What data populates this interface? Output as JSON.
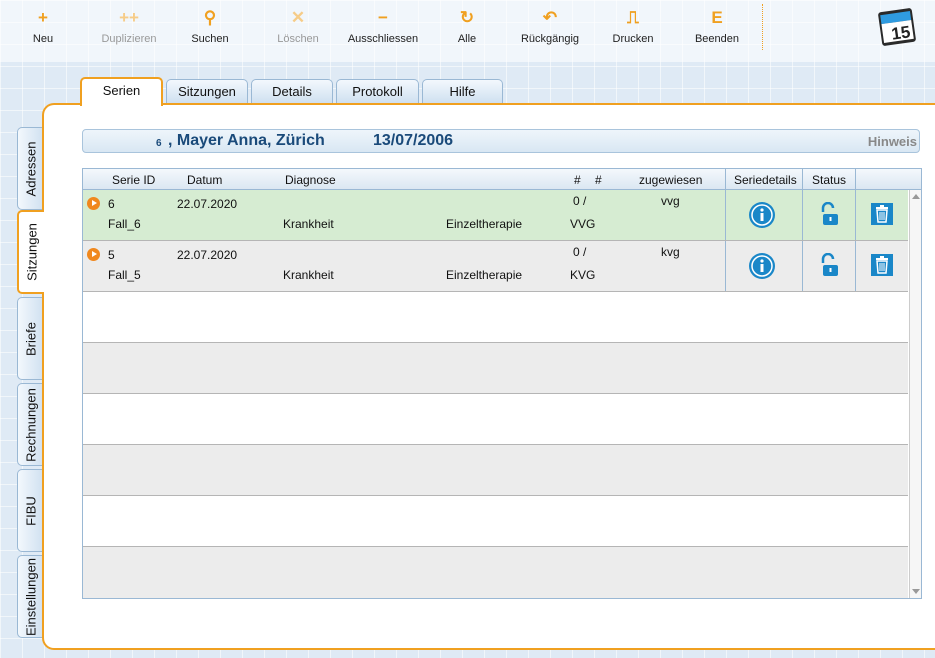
{
  "toolbar": {
    "buttons": [
      {
        "label": "Neu",
        "icon": "+",
        "enabled": true
      },
      {
        "label": "Duplizieren",
        "icon": "++",
        "enabled": false
      },
      {
        "label": "Suchen",
        "icon": "⚲",
        "enabled": true
      },
      {
        "label": "Löschen",
        "icon": "✕",
        "enabled": false
      },
      {
        "label": "Ausschliessen",
        "icon": "−",
        "enabled": true
      },
      {
        "label": "Alle",
        "icon": "↻",
        "enabled": true
      },
      {
        "label": "Rückgängig",
        "icon": "↶",
        "enabled": true
      },
      {
        "label": "Drucken",
        "icon": "⎍",
        "enabled": true
      },
      {
        "label": "Beenden",
        "icon": "E",
        "enabled": true
      }
    ],
    "calendar_day": "15",
    "accent_color": "#f0a020"
  },
  "top_tabs": [
    "Serien",
    "Sitzungen",
    "Details",
    "Protokoll",
    "Hilfe"
  ],
  "active_top_tab": "Serien",
  "side_tabs": [
    "Adressen",
    "Sitzungen",
    "Briefe",
    "Rechnungen",
    "FIBU",
    "Einstellungen"
  ],
  "active_side_tab": "Sitzungen",
  "patient": {
    "id": "6",
    "name": ", Mayer Anna, Zürich",
    "date": "13/07/2006",
    "hinweis": "Hinweis"
  },
  "table": {
    "headers": {
      "serie_id": "Serie ID",
      "datum": "Datum",
      "diagnose": "Diagnose",
      "hash1": "#",
      "hash2": "#",
      "zugewiesen": "zugewiesen",
      "seriedetails": "Seriedetails",
      "status": "Status"
    },
    "rows": [
      {
        "serie_id": "6",
        "datum": "22.07.2020",
        "count": "0 /",
        "zugewiesen": "vvg",
        "fall": "Fall_6",
        "diagnose": "Krankheit",
        "therapie": "Einzeltherapie",
        "versicherung": "VVG",
        "row_color": "#d6ecd2"
      },
      {
        "serie_id": "5",
        "datum": "22.07.2020",
        "count": "0 /",
        "zugewiesen": "kvg",
        "fall": "Fall_5",
        "diagnose": "Krankheit",
        "therapie": "Einzeltherapie",
        "versicherung": "KVG",
        "row_color": "#ececec"
      }
    ]
  }
}
